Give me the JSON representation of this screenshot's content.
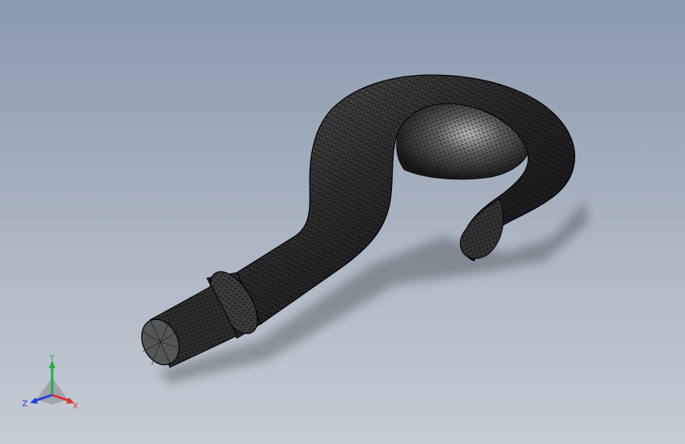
{
  "viewport": {
    "background_top": "#8a9aaf",
    "background_bottom": "#c6ccd6",
    "model_fill": "#2a2a2a",
    "mesh_color": "#0a0a0a",
    "highlight_color": "#d8d8d8"
  },
  "triad": {
    "x_label": "X",
    "y_label": "Y",
    "z_label": "Z",
    "x_color": "#e03030",
    "y_color": "#20b040",
    "z_color": "#2040e0"
  }
}
